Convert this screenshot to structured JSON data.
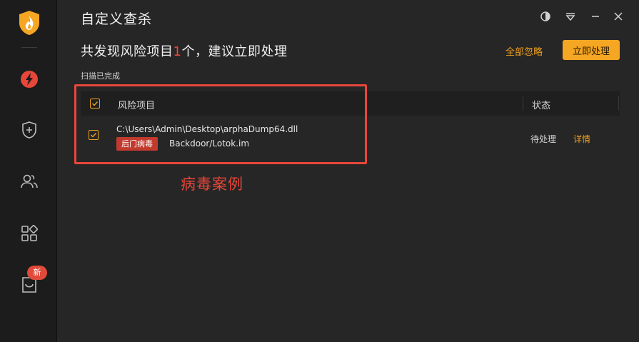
{
  "header": {
    "title": "自定义查杀"
  },
  "summary": {
    "prefix": "共发现风险项目",
    "count": "1",
    "suffix": "个，建议立即处理",
    "ignore_all_label": "全部忽略",
    "process_now_label": "立即处理",
    "scan_status": "扫描已完成"
  },
  "sidebar": {
    "items": [
      {
        "name": "virus-scan",
        "icon": "lightning-icon"
      },
      {
        "name": "system-protection",
        "icon": "shield-plus-icon"
      },
      {
        "name": "users",
        "icon": "users-icon"
      },
      {
        "name": "tools",
        "icon": "grid-icon"
      },
      {
        "name": "message-box",
        "icon": "inbox-icon"
      }
    ],
    "new_badge": "新"
  },
  "table": {
    "columns": [
      "风险项目",
      "状态"
    ],
    "rows": [
      {
        "checked": true,
        "path": "C:\\Users\\Admin\\Desktop\\arphaDump64.dll",
        "tag": "后门病毒",
        "threat": "Backdoor/Lotok.im",
        "status": "待处理",
        "action": "详情"
      }
    ]
  },
  "annotation": {
    "text": "病毒案例"
  },
  "colors": {
    "accent": "#f5a623",
    "danger": "#e8463a",
    "background": "#262626",
    "sidebar": "#1c1c1c"
  }
}
